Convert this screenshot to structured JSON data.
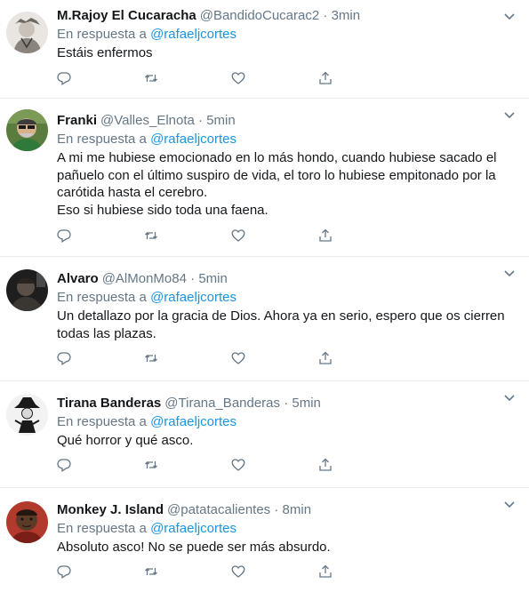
{
  "tweets": [
    {
      "name": "M.Rajoy El Cucaracha",
      "handle": "@BandidoCucarac2",
      "time": "3min",
      "reply_prefix": "En respuesta a",
      "reply_to": "@rafaeljcortes",
      "text": "Estáis enfermos",
      "avatar": "man-with-leaf-crown-avatar"
    },
    {
      "name": "Franki",
      "handle": "@Valles_Elnota",
      "time": "5min",
      "reply_prefix": "En respuesta a",
      "reply_to": "@rafaeljcortes",
      "text": "A mi me hubiese emocionado en lo más hondo, cuando hubiese sacado el\npañuelo con el último suspiro de vida, el toro lo hubiese empitonado por la\ncarótida hasta el cerebro.\nEso si hubiese sido toda una faena.",
      "avatar": "man-with-sunglasses-avatar"
    },
    {
      "name": "Alvaro",
      "handle": "@AlMonMo84",
      "time": "5min",
      "reply_prefix": "En respuesta a",
      "reply_to": "@rafaeljcortes",
      "text": "Un detallazo por la gracia de Dios. Ahora ya en serio, espero que os cierren\ntodas las plazas.",
      "avatar": "dark-photo-avatar"
    },
    {
      "name": "Tirana Banderas",
      "handle": "@Tirana_Banderas",
      "time": "5min",
      "reply_prefix": "En respuesta a",
      "reply_to": "@rafaeljcortes",
      "text": "Qué horror y qué asco.",
      "avatar": "figure-with-hat-avatar"
    },
    {
      "name": "Monkey J. Island",
      "handle": "@patatacalientes",
      "time": "8min",
      "reply_prefix": "En respuesta a",
      "reply_to": "@rafaeljcortes",
      "text": "Absoluto asco! No se puede ser más absurdo.",
      "avatar": "man-portrait-avatar"
    }
  ],
  "separator": "·",
  "colors": {
    "link": "#1b95e0",
    "secondary": "#657786",
    "border": "#e6ecf0"
  },
  "icons": [
    "reply-icon",
    "retweet-icon",
    "like-icon",
    "share-icon",
    "chevron-down-icon"
  ]
}
